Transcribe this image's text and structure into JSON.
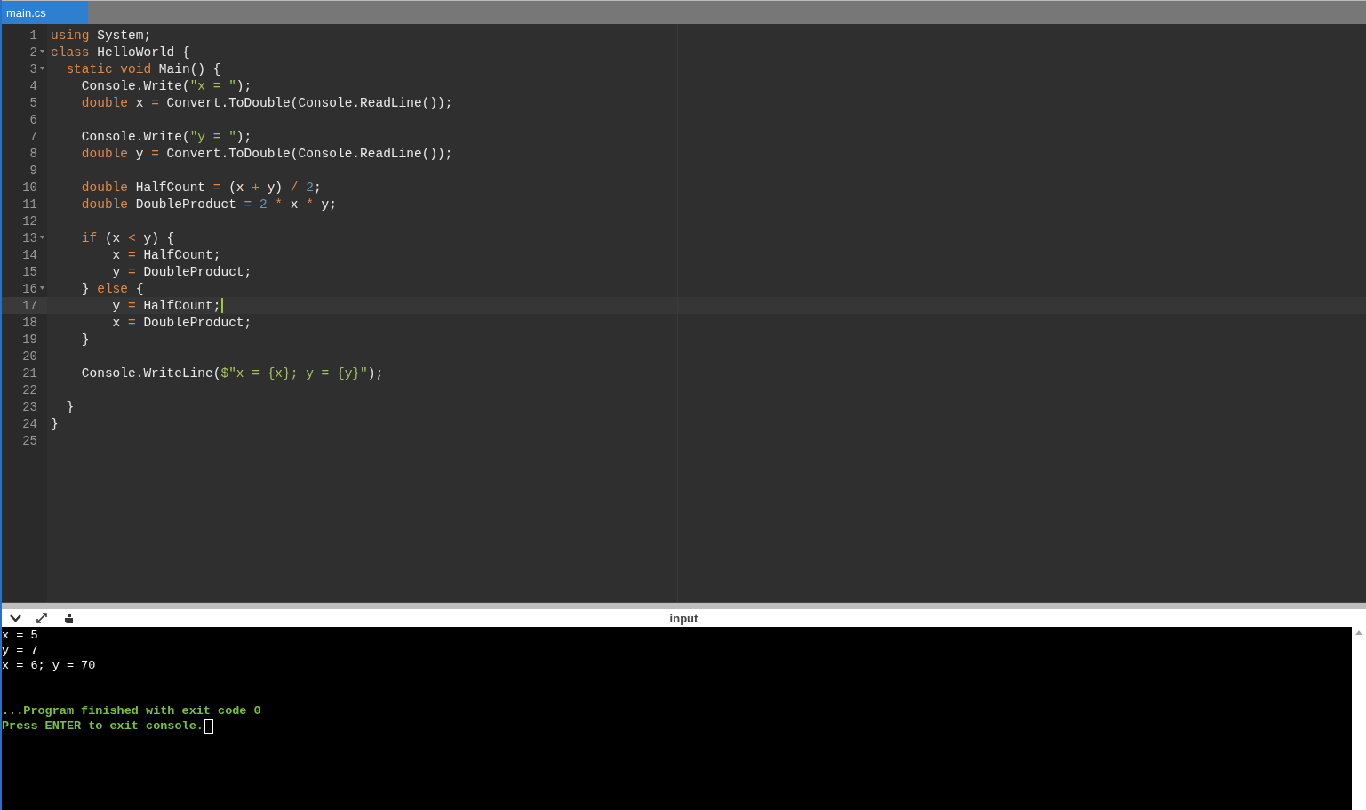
{
  "tabs": [
    {
      "label": "main.cs",
      "selected": true
    }
  ],
  "editor": {
    "lines": [
      {
        "number": "1",
        "foldable": false,
        "active": false,
        "tokens": [
          {
            "kind": "keyword",
            "text": "using"
          },
          {
            "kind": "plain",
            "text": " System;"
          }
        ]
      },
      {
        "number": "2",
        "foldable": true,
        "active": false,
        "tokens": [
          {
            "kind": "keyword",
            "text": "class"
          },
          {
            "kind": "plain",
            "text": " HelloWorld {"
          }
        ]
      },
      {
        "number": "3",
        "foldable": true,
        "active": false,
        "tokens": [
          {
            "kind": "keyword",
            "text": "  static void"
          },
          {
            "kind": "plain",
            "text": " Main() {"
          }
        ]
      },
      {
        "number": "4",
        "foldable": false,
        "active": false,
        "tokens": [
          {
            "kind": "plain",
            "text": "    Console.Write("
          },
          {
            "kind": "string",
            "text": "\"x = \""
          },
          {
            "kind": "plain",
            "text": ");"
          }
        ]
      },
      {
        "number": "5",
        "foldable": false,
        "active": false,
        "tokens": [
          {
            "kind": "keyword",
            "text": "    double"
          },
          {
            "kind": "plain",
            "text": " x "
          },
          {
            "kind": "operator",
            "text": "="
          },
          {
            "kind": "plain",
            "text": " Convert.ToDouble(Console.ReadLine());"
          }
        ]
      },
      {
        "number": "6",
        "foldable": false,
        "active": false
      },
      {
        "number": "7",
        "foldable": false,
        "active": false,
        "tokens": [
          {
            "kind": "plain",
            "text": "    Console.Write("
          },
          {
            "kind": "string",
            "text": "\"y = \""
          },
          {
            "kind": "plain",
            "text": ");"
          }
        ]
      },
      {
        "number": "8",
        "foldable": false,
        "active": false,
        "tokens": [
          {
            "kind": "keyword",
            "text": "    double"
          },
          {
            "kind": "plain",
            "text": " y "
          },
          {
            "kind": "operator",
            "text": "="
          },
          {
            "kind": "plain",
            "text": " Convert.ToDouble(Console.ReadLine());"
          }
        ]
      },
      {
        "number": "9",
        "foldable": false,
        "active": false
      },
      {
        "number": "10",
        "foldable": false,
        "active": false,
        "tokens": [
          {
            "kind": "keyword",
            "text": "    double"
          },
          {
            "kind": "plain",
            "text": " HalfCount "
          },
          {
            "kind": "operator",
            "text": "="
          },
          {
            "kind": "plain",
            "text": " (x "
          },
          {
            "kind": "operator",
            "text": "+"
          },
          {
            "kind": "plain",
            "text": " y) "
          },
          {
            "kind": "operator",
            "text": "/"
          },
          {
            "kind": "number",
            "text": " 2"
          },
          {
            "kind": "plain",
            "text": ";"
          }
        ]
      },
      {
        "number": "11",
        "foldable": false,
        "active": false,
        "tokens": [
          {
            "kind": "keyword",
            "text": "    double"
          },
          {
            "kind": "plain",
            "text": " DoubleProduct "
          },
          {
            "kind": "operator",
            "text": "="
          },
          {
            "kind": "number",
            "text": " 2 "
          },
          {
            "kind": "operator",
            "text": "*"
          },
          {
            "kind": "plain",
            "text": " x "
          },
          {
            "kind": "operator",
            "text": "*"
          },
          {
            "kind": "plain",
            "text": " y;"
          }
        ]
      },
      {
        "number": "12",
        "foldable": false,
        "active": false
      },
      {
        "number": "13",
        "foldable": true,
        "active": false,
        "tokens": [
          {
            "kind": "keyword",
            "text": "    if"
          },
          {
            "kind": "plain",
            "text": " (x "
          },
          {
            "kind": "operator",
            "text": "<"
          },
          {
            "kind": "plain",
            "text": " y) {"
          }
        ]
      },
      {
        "number": "14",
        "foldable": false,
        "active": false,
        "tokens": [
          {
            "kind": "plain",
            "text": "        x "
          },
          {
            "kind": "operator",
            "text": "="
          },
          {
            "kind": "plain",
            "text": " HalfCount;"
          }
        ]
      },
      {
        "number": "15",
        "foldable": false,
        "active": false,
        "tokens": [
          {
            "kind": "plain",
            "text": "        y "
          },
          {
            "kind": "operator",
            "text": "="
          },
          {
            "kind": "plain",
            "text": " DoubleProduct;"
          }
        ]
      },
      {
        "number": "16",
        "foldable": true,
        "active": false,
        "tokens": [
          {
            "kind": "plain",
            "text": "    } "
          },
          {
            "kind": "keyword",
            "text": "else"
          },
          {
            "kind": "plain",
            "text": " {"
          }
        ]
      },
      {
        "number": "17",
        "foldable": false,
        "active": true,
        "tokens": [
          {
            "kind": "plain",
            "text": "        y "
          },
          {
            "kind": "operator",
            "text": "="
          },
          {
            "kind": "plain",
            "text": " HalfCount;"
          }
        ]
      },
      {
        "number": "18",
        "foldable": false,
        "active": false,
        "tokens": [
          {
            "kind": "plain",
            "text": "        x "
          },
          {
            "kind": "operator",
            "text": "="
          },
          {
            "kind": "plain",
            "text": " DoubleProduct;"
          }
        ]
      },
      {
        "number": "19",
        "foldable": false,
        "active": false,
        "tokens": [
          {
            "kind": "plain",
            "text": "    }"
          }
        ]
      },
      {
        "number": "20",
        "foldable": false,
        "active": false
      },
      {
        "number": "21",
        "foldable": false,
        "active": false,
        "tokens": [
          {
            "kind": "plain",
            "text": "    Console.WriteLine("
          },
          {
            "kind": "string",
            "text": "$\"x = {x}; y = {y}\""
          },
          {
            "kind": "plain",
            "text": ");"
          }
        ]
      },
      {
        "number": "22",
        "foldable": false,
        "active": false
      },
      {
        "number": "23",
        "foldable": false,
        "active": false,
        "tokens": [
          {
            "kind": "plain",
            "text": "  }"
          }
        ]
      },
      {
        "number": "24",
        "foldable": false,
        "active": false,
        "tokens": [
          {
            "kind": "plain",
            "text": "}"
          }
        ]
      },
      {
        "number": "25",
        "foldable": false,
        "active": false
      }
    ]
  },
  "console": {
    "title": "input",
    "cursor": true,
    "lines": [
      {
        "kind": "output",
        "text": "x = 5"
      },
      {
        "kind": "output",
        "text": "y = 7"
      },
      {
        "kind": "output",
        "text": "x = 6; y = 70"
      },
      {
        "kind": "status",
        "text": "...Program finished with exit code 0"
      },
      {
        "kind": "status",
        "text": "Press ENTER to exit console."
      }
    ]
  }
}
